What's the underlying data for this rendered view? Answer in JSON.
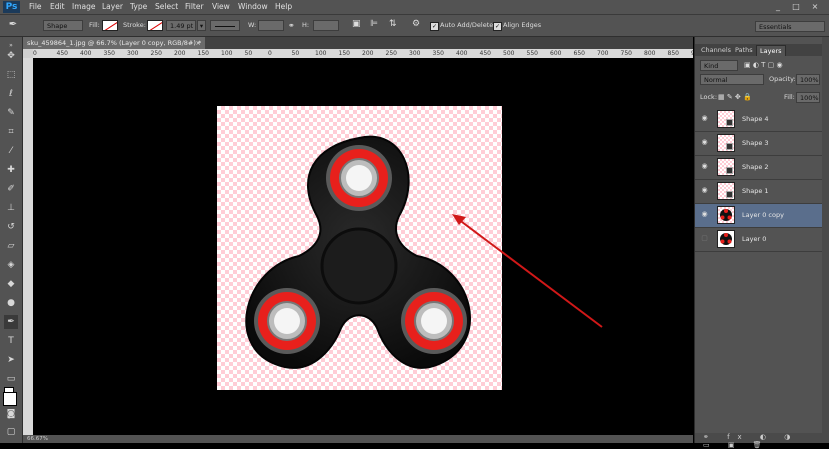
{
  "app": {
    "logo": "Ps"
  },
  "menu": [
    "File",
    "Edit",
    "Image",
    "Layer",
    "Type",
    "Select",
    "Filter",
    "View",
    "Window",
    "Help"
  ],
  "window_controls": [
    "_",
    "□",
    "×"
  ],
  "options_bar": {
    "mode": "Shape",
    "fill_label": "Fill:",
    "stroke_label": "Stroke:",
    "stroke_width": "1.49 pt",
    "w_label": "W:",
    "h_label": "H:",
    "auto_add_delete": "Auto Add/Delete",
    "align_edges": "Align Edges",
    "workspace": "Essentials"
  },
  "document": {
    "tab_title": "sku_459864_1.jpg @ 66.7% (Layer 0 copy, RGB/8#) *",
    "close": "×",
    "ruler_labels": [
      "0",
      "450",
      "400",
      "350",
      "300",
      "250",
      "200",
      "150",
      "100",
      "50",
      "0",
      "50",
      "100",
      "150",
      "200",
      "250",
      "300",
      "350",
      "400",
      "450",
      "500",
      "550",
      "600",
      "650",
      "700",
      "750",
      "800",
      "850",
      "900",
      "950",
      "1000",
      "1050"
    ],
    "status": "66.67%"
  },
  "panel": {
    "tabs": [
      "Channels",
      "Paths",
      "Layers"
    ],
    "active_tab": "Layers",
    "filter_kind": "Kind",
    "blend_mode": "Normal",
    "opacity_label": "Opacity:",
    "opacity": "100%",
    "lock_label": "Lock:",
    "fill_label": "Fill:",
    "fill": "100%",
    "layers": [
      {
        "name": "Shape 4",
        "visible": true,
        "selected": false,
        "kind": "shape"
      },
      {
        "name": "Shape 3",
        "visible": true,
        "selected": false,
        "kind": "shape"
      },
      {
        "name": "Shape 2",
        "visible": true,
        "selected": false,
        "kind": "shape"
      },
      {
        "name": "Shape 1",
        "visible": true,
        "selected": false,
        "kind": "shape"
      },
      {
        "name": "Layer 0 copy",
        "visible": true,
        "selected": true,
        "kind": "image"
      },
      {
        "name": "Layer 0",
        "visible": false,
        "selected": false,
        "kind": "image"
      }
    ]
  },
  "colors": {
    "accent_arrow": "#d01818",
    "spinner_red": "#e8201c",
    "selected_layer": "#5a6e8c"
  }
}
